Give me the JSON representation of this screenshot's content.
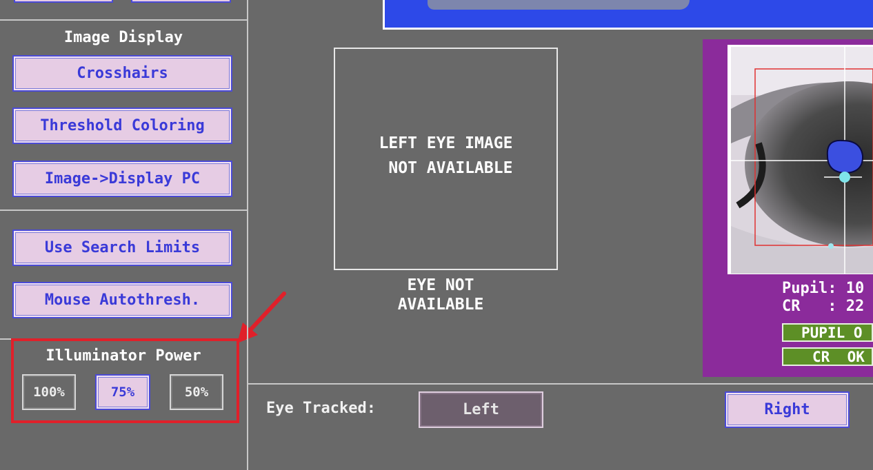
{
  "sidebar": {
    "image_display": {
      "title": "Image Display",
      "buttons": [
        "Crosshairs",
        "Threshold Coloring",
        "Image->Display PC"
      ]
    },
    "search": {
      "buttons": [
        "Use Search Limits",
        "Mouse Autothresh."
      ]
    },
    "illuminator": {
      "title": "Illuminator Power",
      "options": [
        "100%",
        "75%",
        "50%"
      ],
      "selected": "75%"
    }
  },
  "left_eye": {
    "image_text": "LEFT EYE IMAGE\n NOT AVAILABLE",
    "status_text": "EYE NOT\nAVAILABLE"
  },
  "right_eye": {
    "pupil_label": "Pupil: 10",
    "cr_label": "CR   : 22",
    "pupil_status": "PUPIL O",
    "cr_status": "CR  OK"
  },
  "eye_tracked": {
    "label": "Eye Tracked:",
    "left": "Left",
    "right": "Right"
  },
  "colors": {
    "background": "#696969",
    "button_bg": "#e6cce4",
    "button_text": "#3a3ad8",
    "panel_purple": "#8b2b9b",
    "status_green": "#5d8f26",
    "highlight_red": "#e0202a",
    "pupil_blue": "#3b4fe0"
  }
}
